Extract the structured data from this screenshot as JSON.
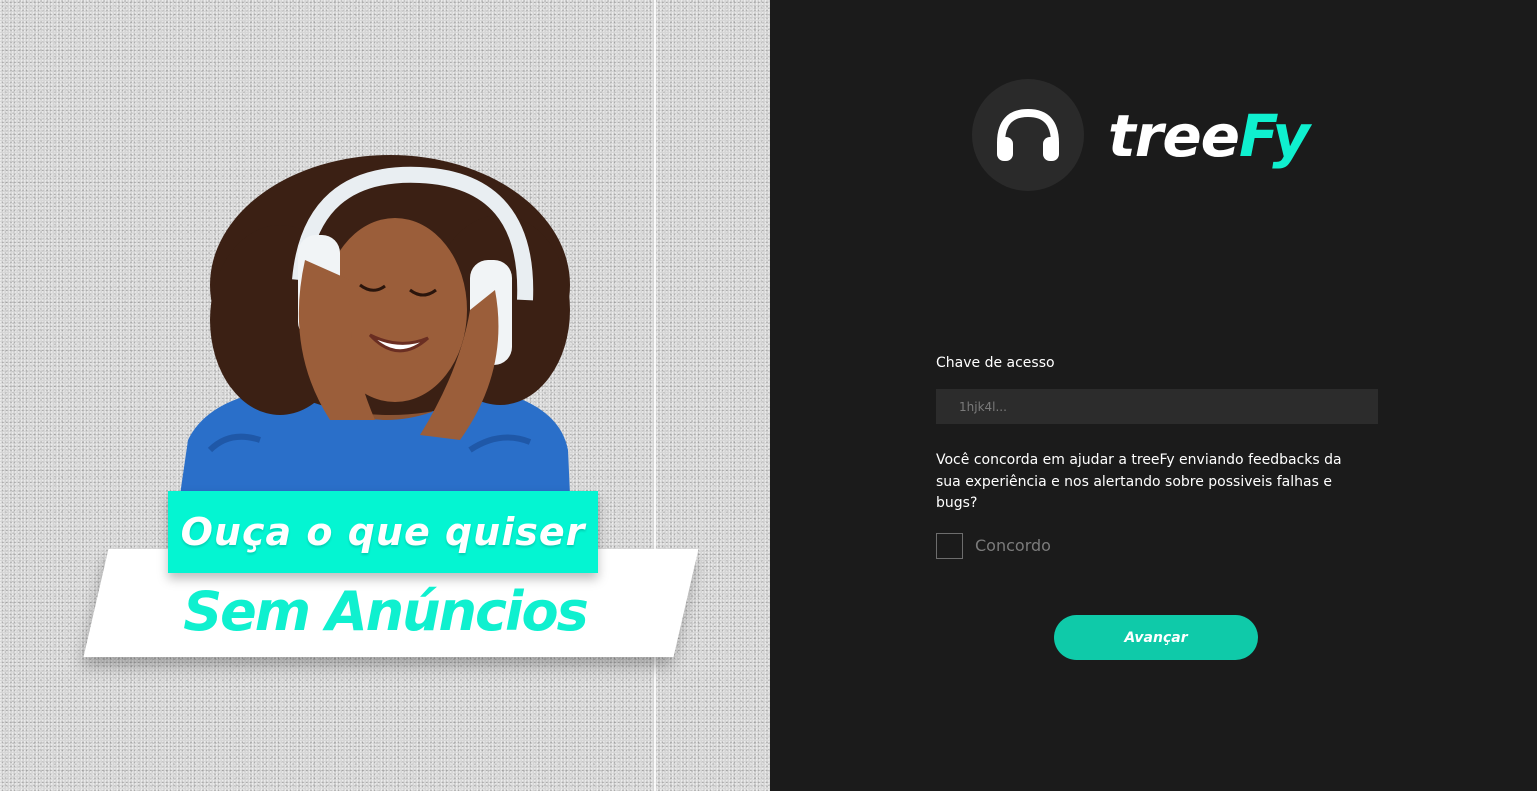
{
  "promo": {
    "headline": "Ouça o que quiser",
    "subheadline": "Sem Anúncios"
  },
  "brand": {
    "name_part1": "tree",
    "name_part2": "Fy",
    "logo_icon": "headphones-icon"
  },
  "form": {
    "access_key_label": "Chave de acesso",
    "access_key_placeholder": "1hjk4l...",
    "access_key_value": "",
    "consent_question": "Você concorda em ajudar a treeFy enviando feedbacks da sua experiência e nos alertando sobre possiveis falhas e bugs?",
    "consent_checkbox_label": "Concordo",
    "consent_checked": false,
    "submit_label": "Avançar"
  },
  "colors": {
    "accent": "#0ff0cf",
    "button": "#0fcaa9",
    "panel_dark": "#1b1b1b",
    "input_bg": "#2c2c2c"
  }
}
